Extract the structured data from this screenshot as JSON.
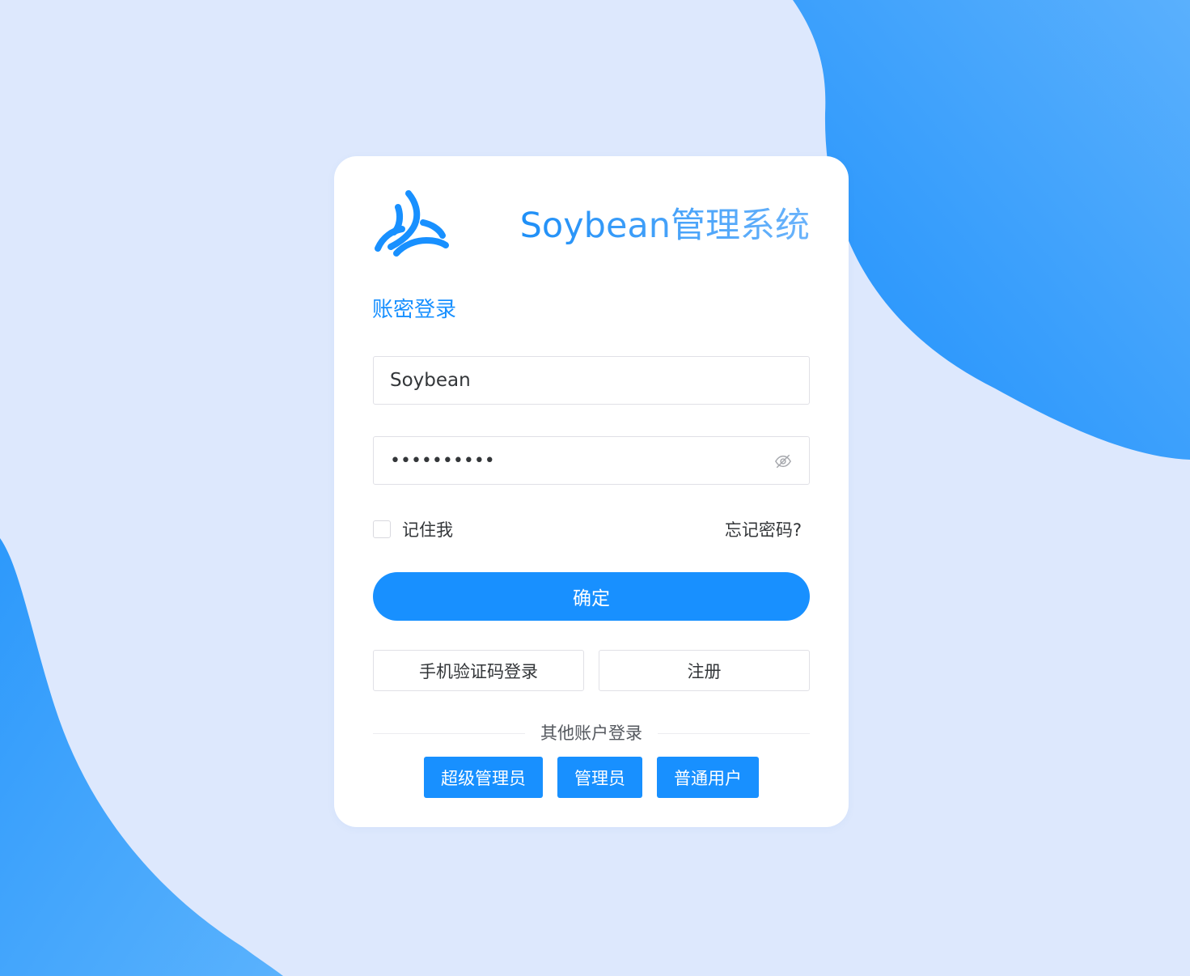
{
  "app": {
    "title": "Soybean管理系统"
  },
  "login": {
    "heading": "账密登录",
    "username_value": "Soybean",
    "password_value": "••••••••••",
    "remember_label": "记住我",
    "forgot_label": "忘记密码?",
    "submit_label": "确定",
    "sms_login_label": "手机验证码登录",
    "register_label": "注册",
    "other_accounts_label": "其他账户登录",
    "roles": [
      "超级管理员",
      "管理员",
      "普通用户"
    ]
  },
  "icons": {
    "logo": "soybean-logo-icon",
    "password_toggle": "eye-off-icon"
  },
  "colors": {
    "primary": "#1890ff",
    "background": "#dde8fd",
    "card": "#ffffff"
  }
}
